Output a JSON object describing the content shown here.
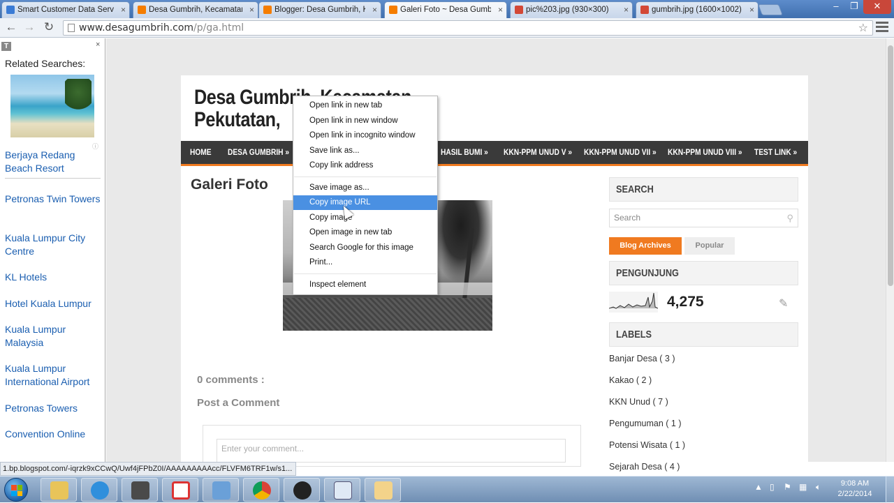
{
  "browser": {
    "tabs": [
      {
        "title": "Smart Customer Data Serv",
        "favicon_color": "#3a7bd5",
        "active": false
      },
      {
        "title": "Desa Gumbrih, Kecamatan",
        "favicon_color": "#f57d00",
        "active": false
      },
      {
        "title": "Blogger: Desa Gumbrih, K",
        "favicon_color": "#f57d00",
        "active": false
      },
      {
        "title": "Galeri Foto ~ Desa Gumbr",
        "favicon_color": "#f57d00",
        "active": true
      },
      {
        "title": "pic%203.jpg (930×300)",
        "favicon_color": "#d34836",
        "active": false
      },
      {
        "title": "gumbrih.jpg (1600×1002)",
        "favicon_color": "#d34836",
        "active": false
      }
    ],
    "url_host": "www.desagumbrih.com",
    "url_path": "/p/ga.html",
    "window_controls": {
      "minimize": "–",
      "maximize": "❐",
      "close": "✕"
    }
  },
  "left_panel": {
    "badge": "T",
    "close": "×",
    "heading": "Related Searches:",
    "info": "ⓘ",
    "links": [
      "Berjaya Redang Beach Resort",
      "Petronas Twin Towers",
      "Kuala Lumpur City Centre",
      "KL Hotels",
      "Hotel Kuala Lumpur",
      "Kuala Lumpur Malaysia",
      "Kuala Lumpur International Airport",
      "Petronas Towers",
      "Convention Online"
    ]
  },
  "blog": {
    "title_line1": "Desa Gumbrih, Kecamatan",
    "title_line2": "Pekutatan,",
    "nav": [
      "HOME",
      "DESA GUMBRIH »",
      "HASIL BUMI »",
      "KKN-PPM UNUD V »",
      "KKN-PPM UNUD VII »",
      "KKN-PPM UNUD VIII »",
      "TEST LINK »"
    ],
    "post_title": "Galeri Foto",
    "comments_count": "0 comments :",
    "post_comment": "Post a Comment",
    "comment_placeholder": "Enter your comment..."
  },
  "sidebar": {
    "search_heading": "SEARCH",
    "search_placeholder": "Search",
    "tab_archives": "Blog Archives",
    "tab_popular": "Popular",
    "visitors_heading": "PENGUNJUNG",
    "visitor_count": "4,275",
    "labels_heading": "LABELS",
    "labels": [
      "Banjar Desa ( 3 )",
      "Kakao ( 2 )",
      "KKN Unud ( 7 )",
      "Pengumuman ( 1 )",
      "Potensi Wisata ( 1 )",
      "Sejarah Desa ( 4 )"
    ]
  },
  "context_menu": {
    "items": [
      "Open link in new tab",
      "Open link in new window",
      "Open link in incognito window",
      "Save link as...",
      "Copy link address",
      "Save image as...",
      "Copy image URL",
      "Copy image",
      "Open image in new tab",
      "Search Google for this image",
      "Print...",
      "Inspect element"
    ],
    "highlighted": "Copy image URL",
    "highlight_color": "#4a90e2"
  },
  "status_bar": "1.bp.blogspot.com/-iqrzk9xCCwQ/Uwf4jFPbZ0I/AAAAAAAAAcc/FLVFM6TRF1w/s1...",
  "taskbar": {
    "apps": [
      "file-explorer",
      "internet-explorer",
      "media-player-321",
      "app-red",
      "control-panel",
      "chrome",
      "obs",
      "notepad",
      "paint"
    ],
    "time": "9:08 AM",
    "date": "2/22/2014"
  },
  "colors": {
    "accent_orange": "#f07a20",
    "nav_dark": "#3a3a3a",
    "link_blue": "#1a5eb0"
  }
}
